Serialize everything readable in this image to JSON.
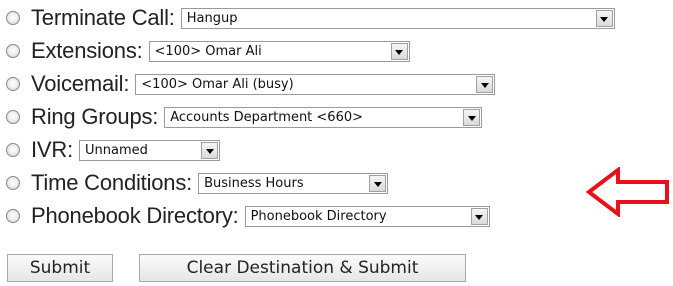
{
  "destinations": [
    {
      "label": "Terminate Call:",
      "value": "Hangup"
    },
    {
      "label": "Extensions:",
      "value": "<100> Omar Ali"
    },
    {
      "label": "Voicemail:",
      "value": "<100> Omar Ali (busy)"
    },
    {
      "label": "Ring Groups:",
      "value": "Accounts Department <660>"
    },
    {
      "label": "IVR:",
      "value": "Unnamed"
    },
    {
      "label": "Time Conditions:",
      "value": "Business Hours"
    },
    {
      "label": "Phonebook Directory:",
      "value": "Phonebook Directory"
    }
  ],
  "buttons": {
    "submit": "Submit",
    "clear_submit": "Clear Destination & Submit"
  },
  "colors": {
    "annotation_arrow": "#e8101a"
  },
  "icons": {
    "annotation": "left-arrow-icon",
    "dropdown": "chevron-down-icon"
  }
}
